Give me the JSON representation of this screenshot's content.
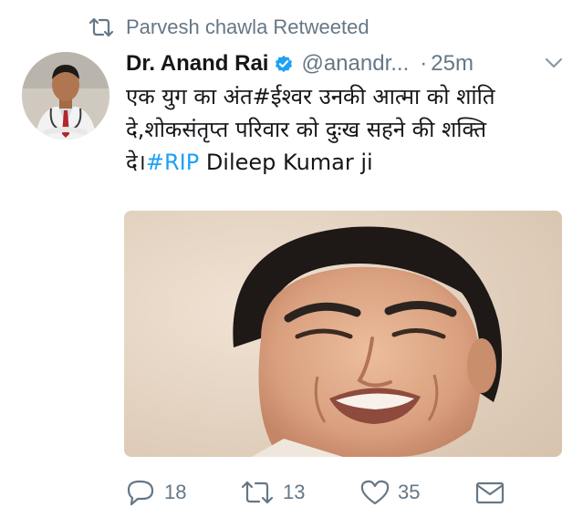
{
  "retweet": {
    "icon": "retweet-icon",
    "text": "Parvesh chawla Retweeted"
  },
  "author": {
    "display_name": "Dr. Anand Rai",
    "verified_icon": "verified-badge-icon",
    "handle": "@anandr...",
    "separator": "·",
    "time": "25m"
  },
  "tweet": {
    "line1": "एक युग का अंत#ईश्वर उनकी आत्मा को शांति",
    "line2": "दे,शोकसंतृप्त परिवार को दुःख सहने की शक्ति",
    "line3_prefix": "दे।",
    "hashtag": "#RIP",
    "line3_suffix": " Dileep Kumar ji"
  },
  "actions": {
    "replies": "18",
    "retweets": "13",
    "likes": "35"
  },
  "colors": {
    "link": "#1da1f2",
    "muted": "#657786",
    "verified": "#1da1f2"
  }
}
